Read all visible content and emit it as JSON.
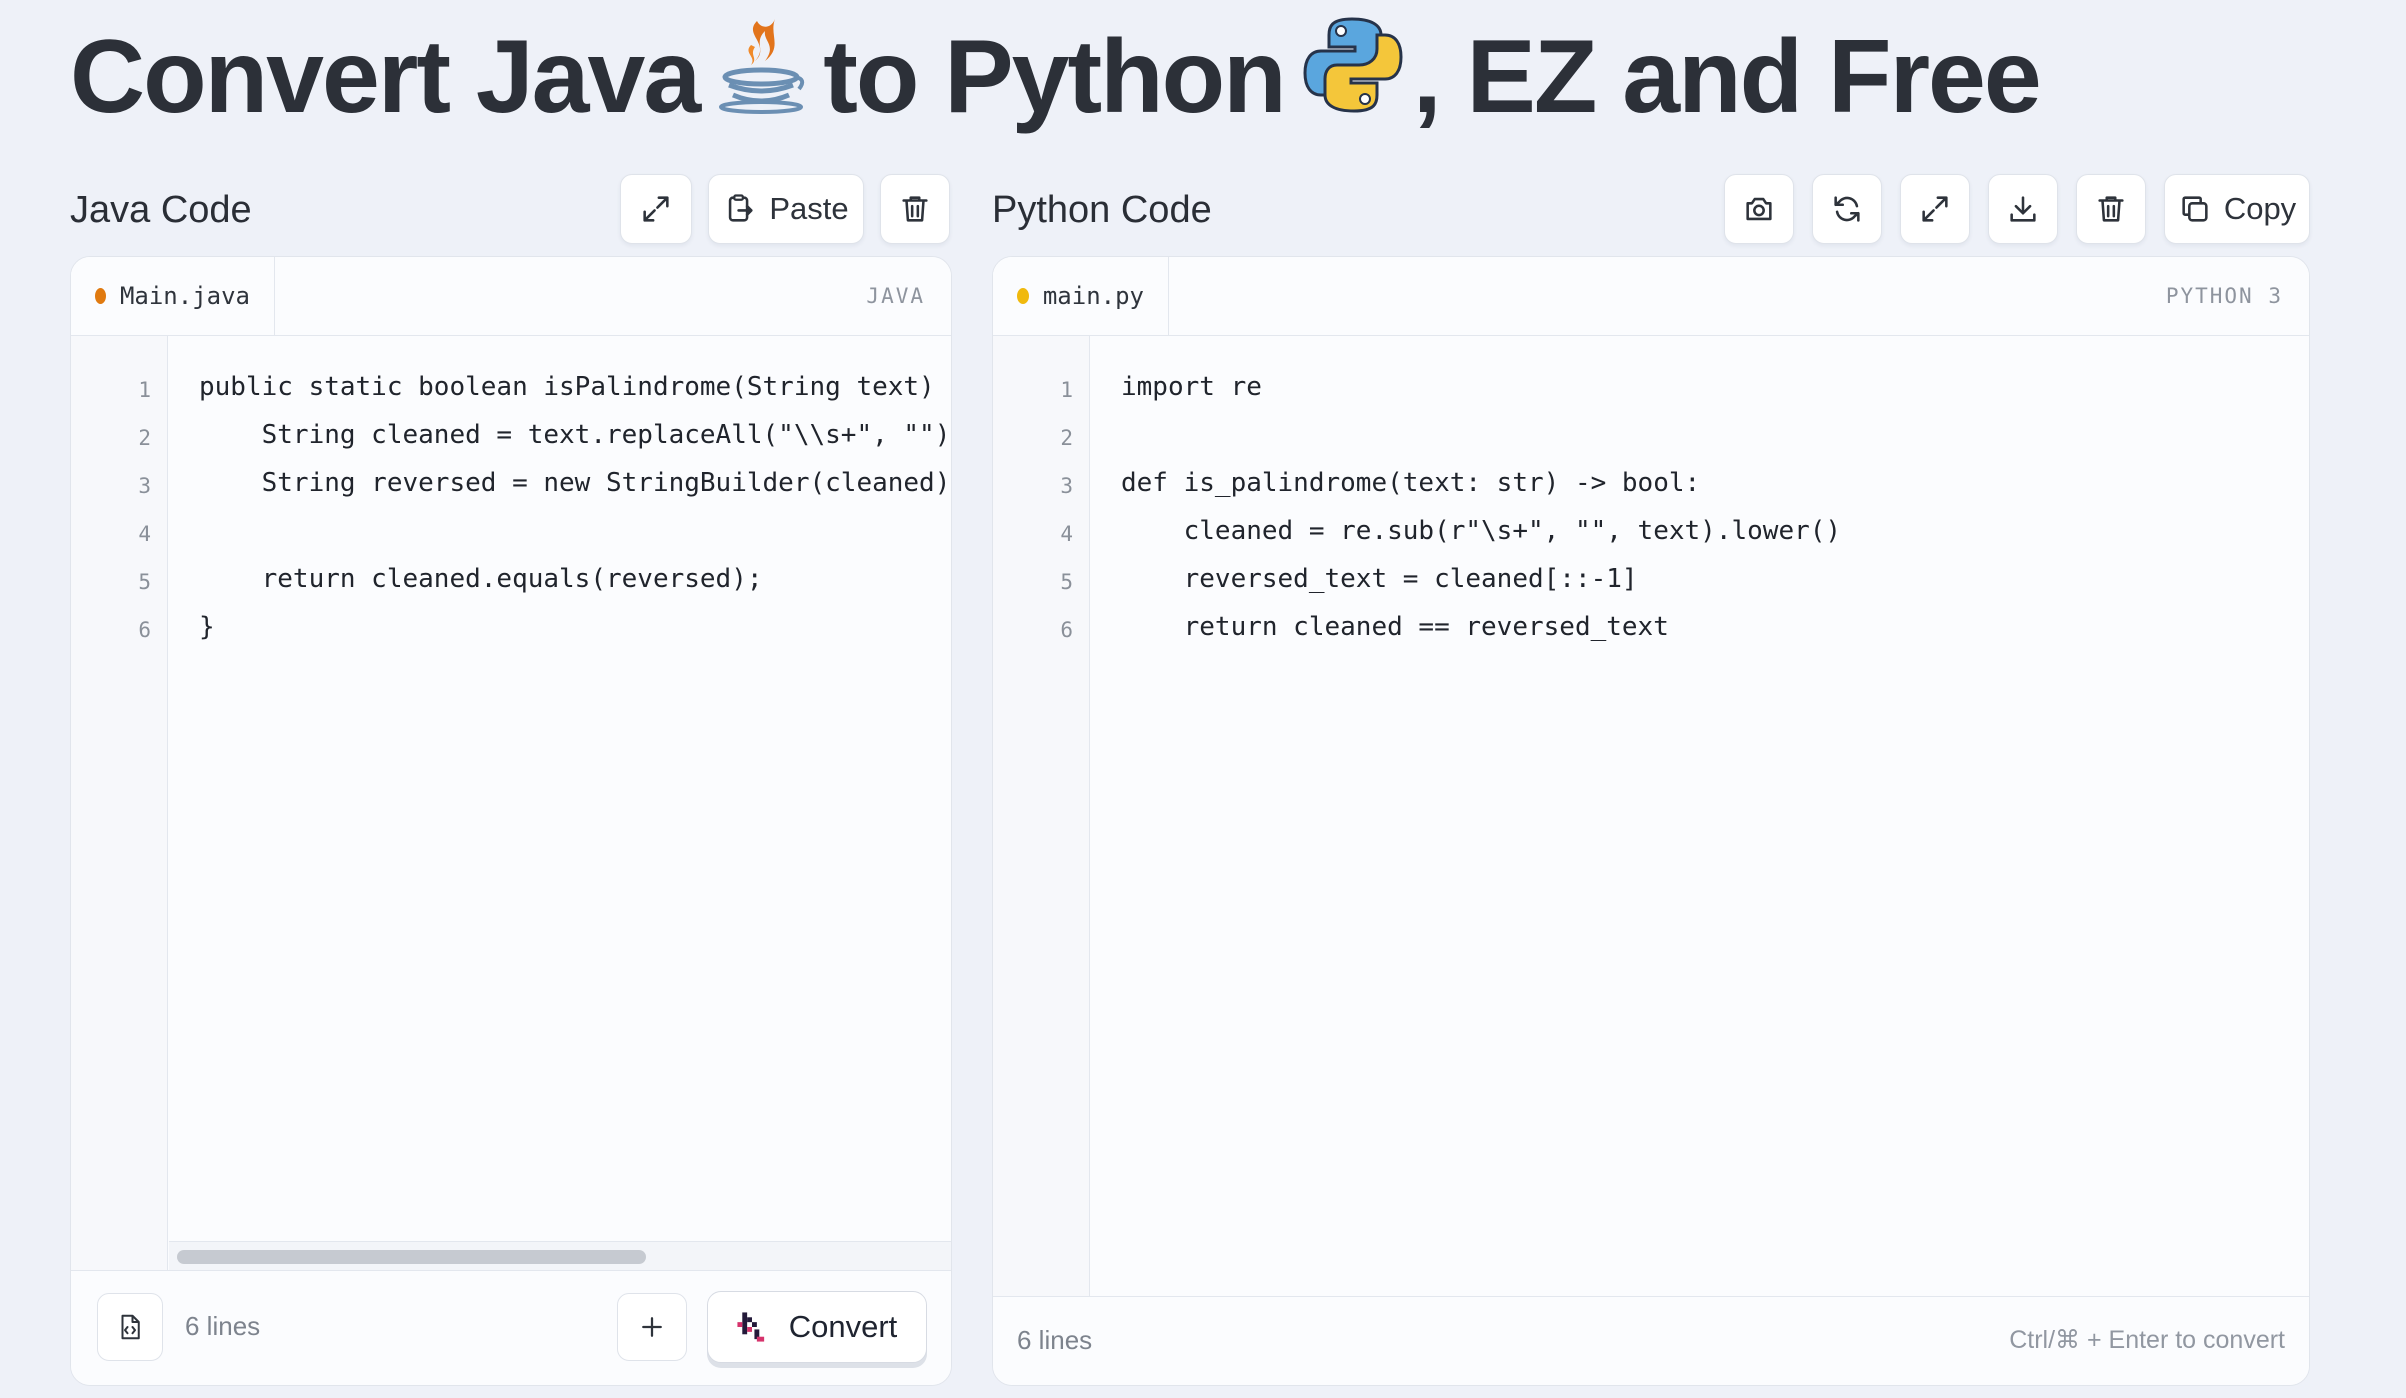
{
  "title": {
    "part1": "Convert Java",
    "part2": "to Python",
    "part3": ", EZ and Free",
    "java_icon": "java-coffee-cup-icon",
    "python_icon": "python-logo-icon"
  },
  "java_panel": {
    "heading": "Java Code",
    "paste_label": "Paste",
    "tab_name": "Main.java",
    "language": "JAVA",
    "dot_color": "#e07a10",
    "line_numbers": [
      "1",
      "2",
      "3",
      "4",
      "5",
      "6"
    ],
    "lines": [
      "public static boolean isPalindrome(String text) {",
      "    String cleaned = text.replaceAll(\"\\\\s+\", \"\").toLowerCase();",
      "    String reversed = new StringBuilder(cleaned).reverse().toString();",
      "",
      "    return cleaned.equals(reversed);",
      "}"
    ],
    "line_count": "6 lines",
    "convert_label": "Convert",
    "scroll_fraction": 0.6
  },
  "python_panel": {
    "heading": "Python Code",
    "copy_label": "Copy",
    "tab_name": "main.py",
    "language": "PYTHON 3",
    "dot_color": "#f0b90e",
    "line_numbers": [
      "1",
      "2",
      "3",
      "4",
      "5",
      "6"
    ],
    "lines": [
      "import re",
      "",
      "def is_palindrome(text: str) -> bool:",
      "    cleaned = re.sub(r\"\\s+\", \"\", text).lower()",
      "    reversed_text = cleaned[::-1]",
      "    return cleaned == reversed_text"
    ],
    "line_count": "6 lines",
    "shortcut_hint": "Ctrl/⌘ + Enter to convert"
  }
}
